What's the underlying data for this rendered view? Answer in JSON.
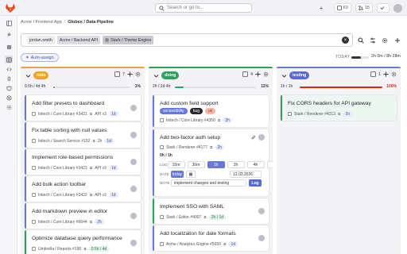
{
  "topbar": {
    "search_placeholder": "Search or go to...",
    "issues_count": "63",
    "mr_count": "15"
  },
  "breadcrumb": [
    "Acme / Frontend App",
    "Globex / Data Pipeline"
  ],
  "filter": {
    "tokens": [
      "jordan.smith",
      "Acme / Backend API",
      "Stark / Theme Engine"
    ]
  },
  "auto_assign": "Auto-assign",
  "today": {
    "label": "TODAY",
    "value": "2h 0m / 8h 28m",
    "progress": 0.55
  },
  "columns": [
    {
      "label": "todo",
      "count": "7",
      "stats": {
        "left": "0.5h / 4d 4h",
        "right": "1%",
        "progress": 0.01
      },
      "colors": {
        "stripe": "#e6a33b",
        "label_bg": "#f0a42a",
        "label_fg": "#ffffff",
        "bar": "#2da160"
      },
      "cards": [
        {
          "title": "Add filter presets to dashboard",
          "ref": "Initech / Core Library #3421",
          "api": "API v3",
          "w": "1d"
        },
        {
          "title": "Fix table sorting with null values",
          "ref": "Initech / Search Service #152",
          "api": "2h",
          "w": "1d"
        },
        {
          "title": "Implement role-based permissions",
          "ref": "Initech / Core Library #3423",
          "api": "API v3",
          "w": "1d"
        },
        {
          "title": "Add bulk action toolbar",
          "ref": "Initech / Core Library #3422",
          "api": "API v3",
          "w": "1d"
        },
        {
          "title": "Add markdown preview in editor",
          "ref": "Initech / Core Library #6644",
          "api": "",
          "w": "2h"
        },
        {
          "title": "Optimize database query performance",
          "ref": "Umbrella / Reports #190",
          "api": "",
          "w": "0.5h / 4d"
        }
      ]
    },
    {
      "label": "doing",
      "count": "4",
      "stats": {
        "left": "2h / 2d 4h",
        "right": "11%",
        "progress": 0.11
      },
      "colors": {
        "stripe": "#2da160",
        "label_bg": "#2da160",
        "label_fg": "#ffffff",
        "bar": "#2da160"
      },
      "cards": [
        {
          "title": "Add custom field support",
          "tags": [
            "accessibility",
            "bug",
            "ux"
          ],
          "ref": "Initech / Core Library #4350",
          "w": "2h"
        },
        {
          "title": "Add two-factor auth setup",
          "ref": "Stark / Renderer #4177",
          "w": "2h"
        },
        {
          "title": "Implement SSO with SAML",
          "ref": "Stark / Editor #4007",
          "w": "2h / 1d"
        },
        {
          "title": "Add localization for date formats",
          "ref": "Acme / Analytics Engine #5650",
          "w": "1d"
        }
      ],
      "time_tracking": {
        "spent": "0h / 1h",
        "log_label": "LOG",
        "options": [
          "15m",
          "30m",
          "1h",
          "2h",
          "4h",
          "1d"
        ],
        "selected": "1h",
        "date_label": "DATE",
        "today_btn": "today",
        "date_value": "12.03.2026",
        "note_label": "NOTE",
        "note_value": "implement changes and testing",
        "log_btn": "Log"
      }
    },
    {
      "label": "testing",
      "count": "1",
      "stats": {
        "left": "1h / 1h",
        "right": "100%",
        "progress": 1.0
      },
      "colors": {
        "stripe": "#6979d8",
        "label_bg": "#5a6ad0",
        "label_fg": "#ffffff",
        "bar": "#dd2b0e"
      },
      "cards": [
        {
          "title": "Fix CORS headers for API gateway",
          "ref": "Stark / Renderer #4213",
          "w": "1h"
        }
      ]
    }
  ]
}
